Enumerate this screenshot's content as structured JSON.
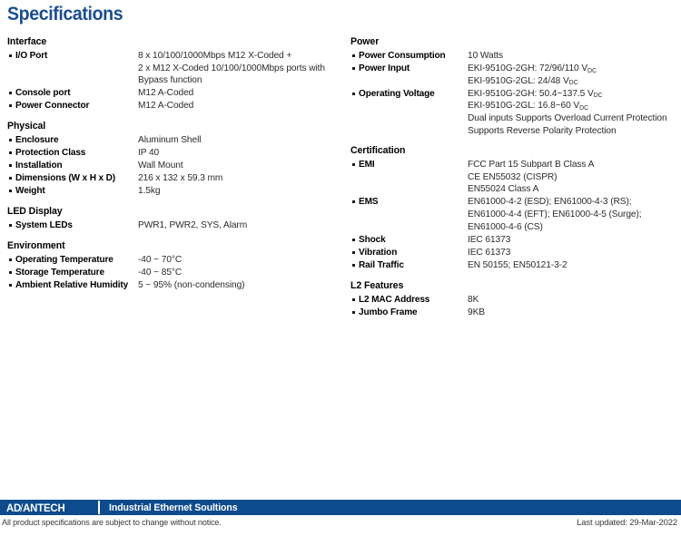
{
  "title": "Specifications",
  "theme": {
    "title_blue": "#1B4D8E",
    "footer_blue": "#0E4B8C",
    "text_black": "#000000",
    "value_gray": "#2B2B2B"
  },
  "left_column": [
    {
      "title": "Interface",
      "rows": [
        {
          "label": "I/O Port",
          "lines": [
            "8 x 10/100/1000Mbps M12 X-Coded +",
            "2 x M12 X-Coded 10/100/1000Mbps ports with",
            "Bypass function"
          ]
        },
        {
          "label": "Console port",
          "lines": [
            "M12 A-Coded"
          ]
        },
        {
          "label": "Power Connector",
          "lines": [
            "M12 A-Coded"
          ]
        }
      ]
    },
    {
      "title": "Physical",
      "rows": [
        {
          "label": "Enclosure",
          "lines": [
            "Aluminum Shell"
          ]
        },
        {
          "label": "Protection Class",
          "lines": [
            "IP 40"
          ]
        },
        {
          "label": "Installation",
          "lines": [
            "Wall Mount"
          ]
        },
        {
          "label": "Dimensions (W x H x D)",
          "lines": [
            "216 x 132 x 59.3 mm"
          ]
        },
        {
          "label": "Weight",
          "lines": [
            "1.5kg"
          ]
        }
      ]
    },
    {
      "title": "LED Display",
      "rows": [
        {
          "label": "System LEDs",
          "lines": [
            "PWR1, PWR2, SYS, Alarm"
          ]
        }
      ]
    },
    {
      "title": "Environment",
      "rows": [
        {
          "label": "Operating Temperature",
          "lines": [
            "-40 ~ 70°C"
          ]
        },
        {
          "label": "Storage Temperature",
          "lines": [
            "-40 ~ 85°C"
          ]
        },
        {
          "label": "Ambient Relative Humidity",
          "lines": [
            "5 ~ 95% (non-condensing)"
          ]
        }
      ]
    }
  ],
  "right_column": [
    {
      "title": "Power",
      "rows": [
        {
          "label": "Power Consumption",
          "lines": [
            "10 Watts"
          ]
        },
        {
          "label": "Power Input",
          "lines": [
            "EKI-9510G-2GH: 72/96/110 V<sub>DC</sub>",
            "EKI-9510G-2GL: 24/48 V<sub>DC</sub>"
          ]
        },
        {
          "label": "Operating Voltage",
          "lines": [
            "EKI-9510G-2GH: 50.4~137.5 V<sub>DC</sub>",
            "EKI-9510G-2GL: 16.8~60 V<sub>DC</sub>",
            "Dual inputs Supports Overload Current Protection",
            "Supports Reverse Polarity Protection"
          ]
        }
      ]
    },
    {
      "title": "Certification",
      "rows": [
        {
          "label": "EMI",
          "lines": [
            "FCC Part 15 Subpart B Class A",
            "CE EN55032 (CISPR)",
            "EN55024 Class A"
          ]
        },
        {
          "label": "EMS",
          "lines": [
            "EN61000-4-2 (ESD); EN61000-4-3 (RS);",
            "EN61000-4-4 (EFT); EN61000-4-5 (Surge);",
            "EN61000-4-6 (CS)"
          ]
        },
        {
          "label": "Shock",
          "lines": [
            "IEC 61373"
          ]
        },
        {
          "label": "Vibration",
          "lines": [
            "IEC 61373"
          ]
        },
        {
          "label": "Rail Traffic",
          "lines": [
            "EN 50155; EN50121-3-2"
          ]
        }
      ]
    },
    {
      "title": "L2 Features",
      "rows": [
        {
          "label": "L2 MAC Address",
          "lines": [
            "8K"
          ]
        },
        {
          "label": "Jumbo Frame",
          "lines": [
            "9KB"
          ]
        }
      ]
    }
  ],
  "footer": {
    "logo_part1": "AD",
    "logo_slash": "\\",
    "logo_part2": "ANTECH",
    "tagline": "Industrial Ethernet Soultions",
    "disclaimer": "All product specifications are subject to change without notice.",
    "last_updated": "Last updated: 29-Mar-2022"
  }
}
